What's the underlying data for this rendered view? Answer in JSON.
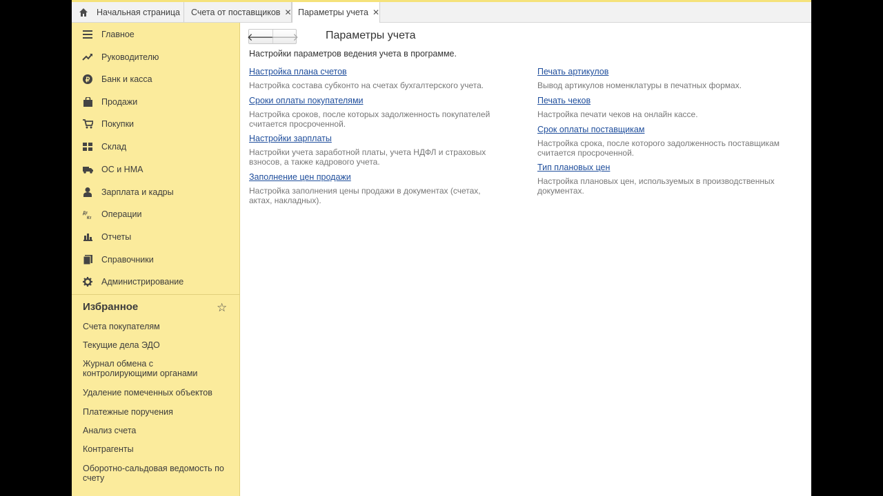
{
  "tabs": [
    {
      "label": "Начальная страница",
      "closable": false,
      "active": false
    },
    {
      "label": "Счета от поставщиков",
      "closable": true,
      "active": false
    },
    {
      "label": "Параметры учета",
      "closable": true,
      "active": true
    }
  ],
  "sidebar": {
    "items": [
      {
        "label": "Главное",
        "icon": "menu-icon"
      },
      {
        "label": "Руководителю",
        "icon": "trend-icon"
      },
      {
        "label": "Банк и касса",
        "icon": "ruble-icon"
      },
      {
        "label": "Продажи",
        "icon": "bag-icon"
      },
      {
        "label": "Покупки",
        "icon": "cart-icon"
      },
      {
        "label": "Склад",
        "icon": "warehouse-icon"
      },
      {
        "label": "ОС и НМА",
        "icon": "truck-icon"
      },
      {
        "label": "Зарплата и кадры",
        "icon": "person-icon"
      },
      {
        "label": "Операции",
        "icon": "operations-icon"
      },
      {
        "label": "Отчеты",
        "icon": "bar-chart-icon"
      },
      {
        "label": "Справочники",
        "icon": "book-icon"
      },
      {
        "label": "Администрирование",
        "icon": "gear-icon"
      }
    ],
    "favorites_title": "Избранное",
    "favorites": [
      "Счета покупателям",
      "Текущие дела ЭДО",
      "Журнал обмена с контролирующими органами",
      "Удаление помеченных объектов",
      "Платежные поручения",
      "Анализ счета",
      "Контрагенты",
      "Оборотно-сальдовая ведомость по счету"
    ]
  },
  "main": {
    "title": "Параметры учета",
    "description": "Настройки параметров ведения учета в программе.",
    "left_settings": [
      {
        "link": "Настройка плана счетов",
        "desc": "Настройка состава субконто на счетах бухгалтерского учета."
      },
      {
        "link": "Сроки оплаты покупателями",
        "desc": "Настройка сроков, после которых задолженность покупателей считается просроченной."
      },
      {
        "link": "Настройки зарплаты",
        "desc": "Настройки учета заработной платы, учета НДФЛ и страховых взносов, а также кадрового учета."
      },
      {
        "link": "Заполнение цен продажи",
        "desc": "Настройка заполнения цены продажи в документах (счетах, актах, накладных)."
      }
    ],
    "right_settings": [
      {
        "link": "Печать артикулов",
        "desc": "Вывод артикулов номенклатуры в печатных формах."
      },
      {
        "link": "Печать чеков",
        "desc": "Настройка печати чеков на онлайн кассе."
      },
      {
        "link": "Срок оплаты поставщикам",
        "desc": "Настройка срока, после которого задолженность поставщикам считается просроченной."
      },
      {
        "link": "Тип плановых цен",
        "desc": "Настройка плановых цен, используемых в производственных документах."
      }
    ]
  },
  "colors": {
    "sidebar_bg": "#fbeb9c",
    "link": "#1f4e9c",
    "accent": "#f5e27a"
  }
}
